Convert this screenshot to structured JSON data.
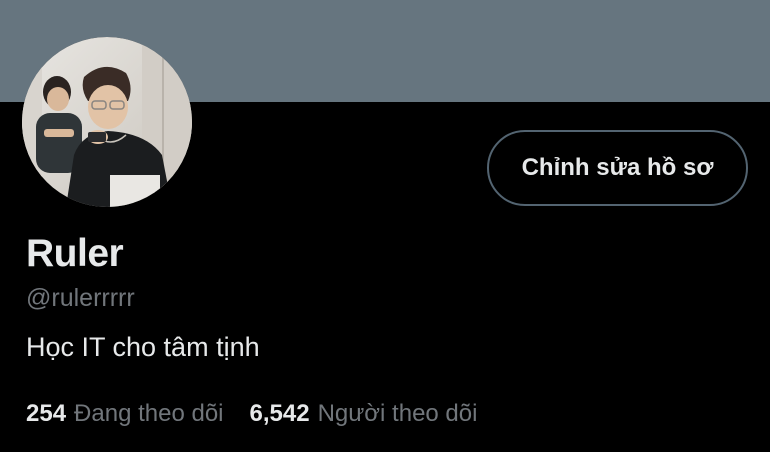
{
  "profile": {
    "display_name": "Ruler",
    "handle": "@rulerrrrr",
    "bio": "Học IT cho tâm tịnh",
    "avatar_description": "profile-photo",
    "edit_button_label": "Chỉnh sửa hồ sơ"
  },
  "stats": {
    "following_count": "254",
    "following_label": "Đang theo dõi",
    "followers_count": "6,542",
    "followers_label": "Người theo dõi"
  },
  "colors": {
    "banner": "#66757f",
    "background": "#000000",
    "primary_text": "#e7e9ea",
    "secondary_text": "#71767b",
    "button_border": "#536471"
  }
}
